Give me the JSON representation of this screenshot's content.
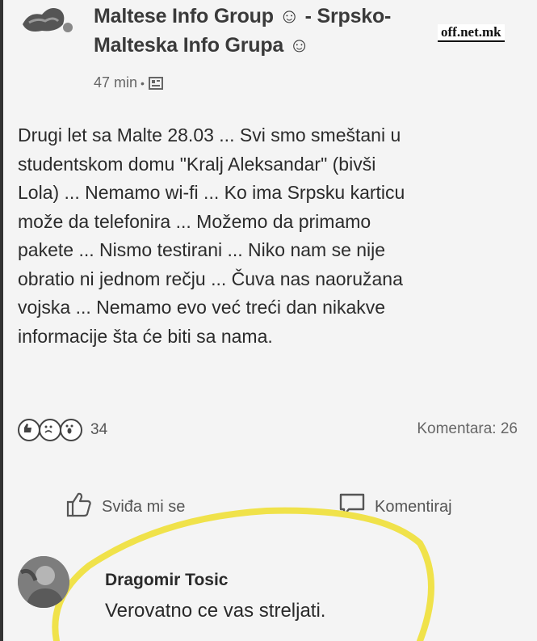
{
  "group": {
    "title": "Maltese Info Group ☺ - Srpsko-Malteska Info Grupa ☺",
    "time": "47 min"
  },
  "watermark": "off.net.mk",
  "post": {
    "text": "Drugi let sa Malte 28.03 ... Svi smo smeštani u\nstudentskom domu \"Kralj Aleksandar\" (bivši\nLola) ... Nemamo wi-fi ... Ko ima Srpsku karticu\nmože da telefonira ... Možemo da primamo\npakete ... Nismo testirani ... Niko nam se nije\nobratio ni jednom rečju ... Čuva nas naoružana\nvojska  ... Nemamo evo već treći dan nikakve\ninformacije šta će biti sa nama."
  },
  "stats": {
    "reaction_count": "34",
    "comments_label": "Komentara: 26"
  },
  "actions": {
    "like_label": "Sviđa mi se",
    "comment_label": "Komentiraj"
  },
  "comment": {
    "author": "Dragomir Tosic",
    "text": "Verovatno ce vas streljati."
  },
  "colors": {
    "highlight": "#f0e24a",
    "text": "#2b2b2b",
    "muted": "#666666"
  },
  "icons": [
    "privacy-icon",
    "like-reaction-icon",
    "sad-reaction-icon",
    "wow-reaction-icon",
    "thumbs-up-icon",
    "comment-bubble-icon"
  ]
}
